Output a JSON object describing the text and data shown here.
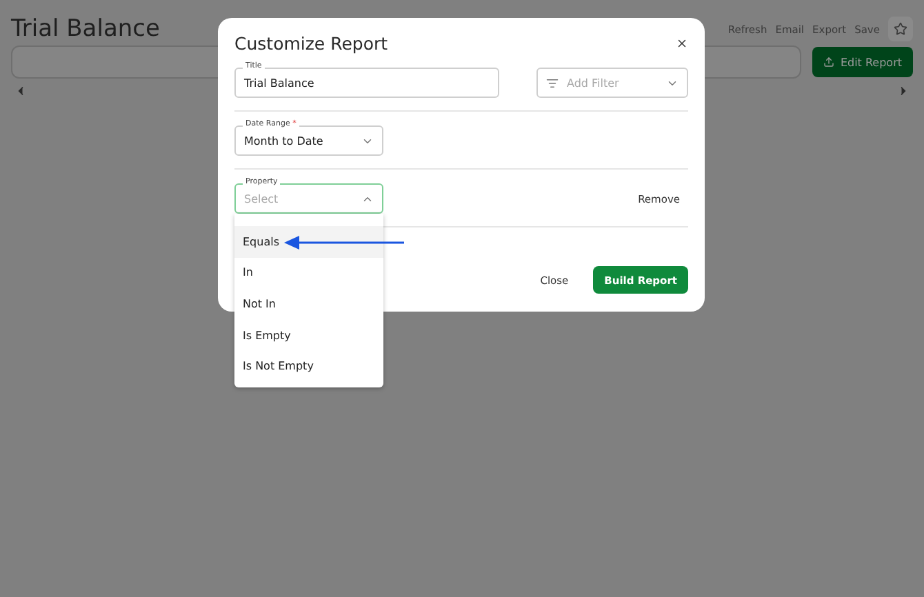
{
  "background": {
    "title": "Trial Balance",
    "actions": [
      "Refresh",
      "Email",
      "Export",
      "Save"
    ],
    "edit_button": "Edit Report"
  },
  "dialog": {
    "title": "Customize Report",
    "title_field": {
      "label": "Title",
      "value": "Trial Balance"
    },
    "add_filter": {
      "placeholder": "Add Filter"
    },
    "date_range": {
      "label": "Date Range",
      "required_mark": "*",
      "value": "Month to Date"
    },
    "property": {
      "label": "Property",
      "placeholder": "Select",
      "expanded": true
    },
    "remove": "Remove",
    "buttons": [
      {
        "label": "Close",
        "kind": "text"
      },
      {
        "label": "Build Report",
        "kind": "primary"
      }
    ]
  },
  "dropdown": {
    "options": [
      {
        "label": "Equals",
        "selected": true
      },
      {
        "label": "In",
        "selected": false
      },
      {
        "label": "Not In",
        "selected": false
      },
      {
        "label": "Is Empty",
        "selected": false
      },
      {
        "label": "Is Not Empty",
        "selected": false
      }
    ]
  }
}
